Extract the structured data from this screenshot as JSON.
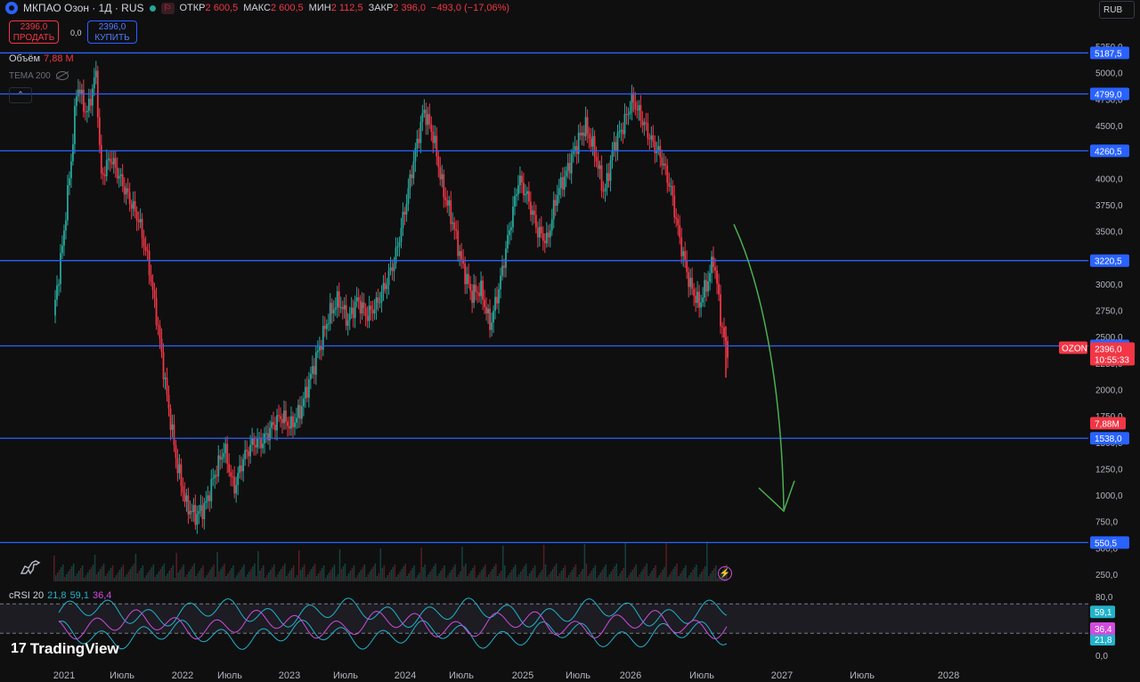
{
  "header": {
    "symbol": "МКПАО Озон · 1Д · RUS",
    "open_label": "ОТКР",
    "open": "2 600,5",
    "high_label": "МАКС",
    "high": "2 600,5",
    "low_label": "МИН",
    "low": "2 112,5",
    "close_label": "ЗАКР",
    "close": "2 396,0",
    "change": "−493,0 (−17,06%)",
    "flag_icon": "flag-icon",
    "up_color": "#26a69a",
    "down_color": "#f23645"
  },
  "trade": {
    "sell_price": "2396,0",
    "sell_label": "ПРОДАТЬ",
    "spread": "0,0",
    "buy_price": "2396,0",
    "buy_label": "КУПИТЬ"
  },
  "currency": "RUB",
  "volume": {
    "label": "Объём",
    "value": "7,88 M"
  },
  "tema": {
    "label": "TEMA 200"
  },
  "collapse_icon": "chevron-up-icon",
  "rsi": {
    "label": "cRSI 20",
    "v1": "21,8",
    "v2": "59,1",
    "v3": "36,4"
  },
  "brand": "TradingView",
  "chart_data": {
    "type": "candlestick",
    "symbol": "OZON",
    "price_axis": {
      "ticks": [
        "5250,0",
        "5000,0",
        "4750,0",
        "4500,0",
        "4250,0",
        "4000,0",
        "3750,0",
        "3500,0",
        "3250,0",
        "3000,0",
        "2750,0",
        "2500,0",
        "2250,0",
        "2000,0",
        "1750,0",
        "1500,0",
        "1250,0",
        "1000,0",
        "750,0",
        "500,0",
        "250,0"
      ],
      "tick_values": [
        5250,
        5000,
        4750,
        4500,
        4250,
        4000,
        3750,
        3500,
        3250,
        3000,
        2750,
        2500,
        2250,
        2000,
        1750,
        1500,
        1250,
        1000,
        750,
        500,
        250
      ],
      "range": [
        250,
        5250
      ]
    },
    "time_axis": {
      "labels": [
        "2021",
        "Июль",
        "2022",
        "Июль",
        "2023",
        "Июль",
        "2024",
        "Июль",
        "2025",
        "Июль",
        "2026",
        "Июль",
        "2027",
        "Июль",
        "2028"
      ]
    },
    "horizontal_levels": [
      {
        "value": 5187.5,
        "label": "5187,5"
      },
      {
        "value": 4799.0,
        "label": "4799,0"
      },
      {
        "value": 4260.5,
        "label": "4260,5"
      },
      {
        "value": 3220.5,
        "label": "3220,5"
      },
      {
        "value": 2413.0,
        "label": "2413,0"
      },
      {
        "value": 1538.0,
        "label": "1538,0"
      },
      {
        "value": 550.5,
        "label": "550,5"
      }
    ],
    "level_color": "#2962ff",
    "last_price": {
      "value": 2396.0,
      "label": "2396,0",
      "ticker": "OZON",
      "countdown": "10:55:33"
    },
    "volume_badge": "7,88M",
    "price_path": [
      [
        0.0,
        2700
      ],
      [
        0.01,
        3400
      ],
      [
        0.02,
        4300
      ],
      [
        0.025,
        4900
      ],
      [
        0.035,
        4600
      ],
      [
        0.045,
        5000
      ],
      [
        0.05,
        4000
      ],
      [
        0.06,
        4200
      ],
      [
        0.07,
        4000
      ],
      [
        0.08,
        3800
      ],
      [
        0.09,
        3600
      ],
      [
        0.1,
        3200
      ],
      [
        0.11,
        2600
      ],
      [
        0.12,
        1900
      ],
      [
        0.13,
        1300
      ],
      [
        0.14,
        900
      ],
      [
        0.15,
        800
      ],
      [
        0.16,
        900
      ],
      [
        0.17,
        1200
      ],
      [
        0.18,
        1450
      ],
      [
        0.19,
        1050
      ],
      [
        0.2,
        1350
      ],
      [
        0.21,
        1500
      ],
      [
        0.22,
        1500
      ],
      [
        0.23,
        1650
      ],
      [
        0.24,
        1750
      ],
      [
        0.25,
        1650
      ],
      [
        0.26,
        1800
      ],
      [
        0.27,
        2100
      ],
      [
        0.28,
        2400
      ],
      [
        0.29,
        2700
      ],
      [
        0.3,
        2850
      ],
      [
        0.31,
        2650
      ],
      [
        0.32,
        2850
      ],
      [
        0.33,
        2700
      ],
      [
        0.34,
        2800
      ],
      [
        0.35,
        3000
      ],
      [
        0.36,
        3250
      ],
      [
        0.37,
        3700
      ],
      [
        0.38,
        4200
      ],
      [
        0.39,
        4650
      ],
      [
        0.4,
        4400
      ],
      [
        0.41,
        3900
      ],
      [
        0.42,
        3600
      ],
      [
        0.43,
        3200
      ],
      [
        0.44,
        2900
      ],
      [
        0.45,
        2950
      ],
      [
        0.46,
        2600
      ],
      [
        0.47,
        3000
      ],
      [
        0.48,
        3500
      ],
      [
        0.49,
        4000
      ],
      [
        0.5,
        3800
      ],
      [
        0.51,
        3500
      ],
      [
        0.52,
        3400
      ],
      [
        0.53,
        3850
      ],
      [
        0.54,
        4050
      ],
      [
        0.55,
        4300
      ],
      [
        0.56,
        4500
      ],
      [
        0.57,
        4250
      ],
      [
        0.58,
        3850
      ],
      [
        0.59,
        4300
      ],
      [
        0.6,
        4500
      ],
      [
        0.61,
        4750
      ],
      [
        0.62,
        4550
      ],
      [
        0.63,
        4350
      ],
      [
        0.64,
        4200
      ],
      [
        0.65,
        3900
      ],
      [
        0.66,
        3400
      ],
      [
        0.67,
        3000
      ],
      [
        0.68,
        2800
      ],
      [
        0.69,
        3050
      ],
      [
        0.695,
        3250
      ],
      [
        0.7,
        2900
      ],
      [
        0.705,
        2500
      ],
      [
        0.71,
        2396
      ]
    ],
    "rsi_range": [
      0,
      80
    ],
    "rsi_ticks": [
      "80,0",
      "0,0"
    ],
    "rsi_series": [
      {
        "color": "#21b2c9",
        "value": 59.1
      },
      {
        "color": "#21b2c9",
        "value": 21.8
      },
      {
        "color": "#d14be0",
        "value": 36.4
      }
    ]
  },
  "annotation_arrow_color": "#4caf50"
}
